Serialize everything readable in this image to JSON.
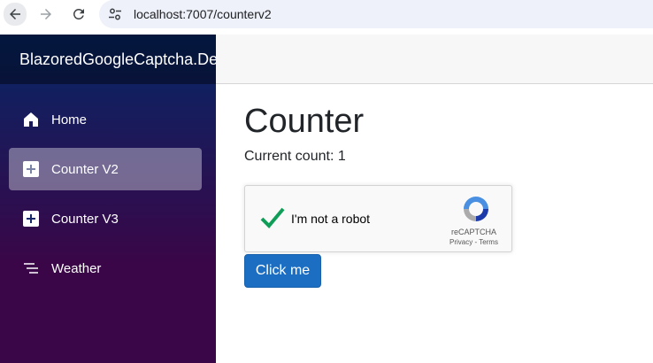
{
  "browser": {
    "url": "localhost:7007/counterv2"
  },
  "sidebar": {
    "brand": "BlazoredGoogleCaptcha.Demo",
    "items": [
      {
        "label": "Home",
        "icon": "home-icon"
      },
      {
        "label": "Counter V2",
        "icon": "plus-square-icon",
        "active": true
      },
      {
        "label": "Counter V3",
        "icon": "plus-square-icon"
      },
      {
        "label": "Weather",
        "icon": "list-lines-icon"
      }
    ]
  },
  "main": {
    "title": "Counter",
    "count_text": "Current count: 1",
    "captcha": {
      "label": "I'm not a robot",
      "brand": "reCAPTCHA",
      "links": "Privacy - Terms"
    },
    "button_label": "Click me"
  },
  "colors": {
    "sidebar_top": "#052767",
    "sidebar_bottom": "#3a0647",
    "button": "#1b6ec2",
    "check": "#0f9d58"
  }
}
